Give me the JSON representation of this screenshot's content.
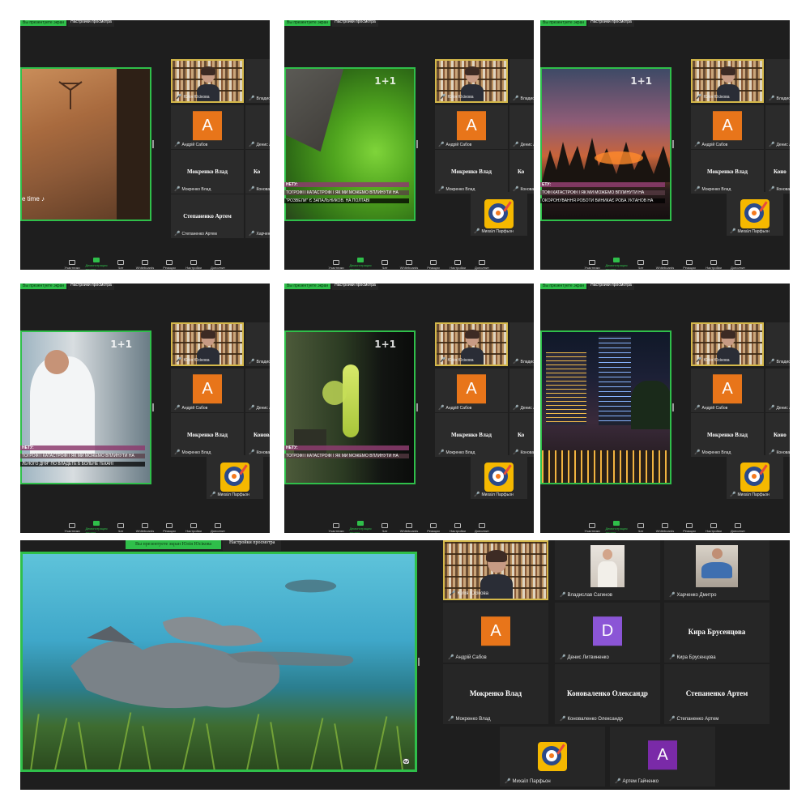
{
  "toolbar": [
    "Участники",
    "Демонстрация экрана",
    "Чат",
    "Whiteboards",
    "Реакции",
    "Настройки",
    "Дополнит"
  ],
  "share_bar": {
    "presenting": "Вы презентуете экран",
    "options": "Настройки просмотра"
  },
  "big_share_bar": {
    "presenting": "Вы презентуете экран Юлія Юсікова",
    "options": "Настройки просмотра"
  },
  "channel_logo": "1+1",
  "panel1_caption": "e time ♪",
  "panel2_tickers": [
    "НЕТУ:",
    "ТОГРОФІ Ї КАТАСТРОФІ І ЯК МИ МОЖЕМО ВПЛИНУТИ НА",
    "\"РОЗВЕЛИ\" Є ЗАПАЛЬНИКОВ. НА ПОЛТАВІ"
  ],
  "panel3_tickers": [
    "ЕТУ:",
    "ТОФІ КАТАСТРОФІ І ЯК МИ МОЖЕМО ВПЛИНУТИ НА",
    "ОКОРОНУВАННЯ РОБОТИ ВИНИКАЄ РОБА УКТАНОВ НА"
  ],
  "panel4_tickers": [
    "НЕТУ:",
    "ТОГРОФІ Ї КАТАСТРОФІ І ЯК МИ МОЖЕМО ВПЛИНУТИ НА",
    "ЛЬНОГО ДНЯ\" ПО ВЛАДЕТЕ Б БОЛЬНЕ   ГЕКАНІ"
  ],
  "panel5_tickers": [
    "НЕТУ:",
    "ТОГРОФІ Ї КАТАСТРОФІ І ЯК МИ МОЖЕМО ВПЛИНУТИ НА"
  ],
  "small_panels": [
    {
      "tiles": [
        {
          "type": "self",
          "label": "Юлія Юсікова"
        },
        {
          "type": "letter",
          "letter": "A",
          "color": "#e8751a",
          "label": "Андрій Сабов"
        },
        {
          "type": "name",
          "name": "Мокренко Влад",
          "label": "Мокренко Влад"
        },
        {
          "type": "name",
          "name": "Степаненко Артем",
          "label": "Степаненко Артем"
        },
        {
          "type": "cut",
          "label": "Владислав Сагинов"
        },
        {
          "type": "cut",
          "label": "Денис Литвиненко"
        },
        {
          "type": "cut",
          "name": "Ко",
          "label": "Коноваленко Олекс"
        },
        {
          "type": "cut",
          "label": "Харченко Дмитро"
        }
      ]
    },
    {
      "tiles": [
        {
          "type": "self",
          "label": "Юлія Юсікова"
        },
        {
          "type": "letter",
          "letter": "A",
          "color": "#e8751a",
          "label": "Андрій Сабов"
        },
        {
          "type": "name",
          "name": "Мокренко Влад",
          "label": "Мокренко Влад"
        },
        {
          "type": "egg",
          "label": "Михаїл Парфьон"
        },
        {
          "type": "cut",
          "label": "Владислав"
        },
        {
          "type": "cut",
          "label": "Денис Лит"
        },
        {
          "type": "cut",
          "name": "Ко",
          "label": "Коновал"
        }
      ]
    },
    {
      "tiles": [
        {
          "type": "self",
          "label": "Юлія Юсікова"
        },
        {
          "type": "letter",
          "letter": "A",
          "color": "#e8751a",
          "label": "Андрій Сабов"
        },
        {
          "type": "name",
          "name": "Мокренко Влад",
          "label": "Мокренко Влад"
        },
        {
          "type": "egg",
          "label": "Михаїл Парфьон"
        },
        {
          "type": "cut",
          "label": "Владислав Сагинов"
        },
        {
          "type": "cut",
          "label": "Денис Литвиненко"
        },
        {
          "type": "cut",
          "name": "Коно",
          "label": "Коноваленко Олекс"
        }
      ]
    },
    {
      "tiles": [
        {
          "type": "self",
          "label": "Юлія Юсікова"
        },
        {
          "type": "letter",
          "letter": "A",
          "color": "#e8751a",
          "label": "Андрій Сабов"
        },
        {
          "type": "name",
          "name": "Мокренко Влад",
          "label": "Мокренко Влад"
        },
        {
          "type": "egg",
          "label": "Михаїл Парфьон"
        },
        {
          "type": "cut",
          "label": "Владислав Сагин"
        },
        {
          "type": "cut",
          "label": "Денис Литвин"
        },
        {
          "type": "cut",
          "name": "Коновал",
          "label": "Коноваленко Олекс"
        }
      ]
    },
    {
      "tiles": [
        {
          "type": "self",
          "label": "Юлія Юсікова"
        },
        {
          "type": "letter",
          "letter": "A",
          "color": "#e8751a",
          "label": "Андрій Сабов"
        },
        {
          "type": "name",
          "name": "Мокренко Влад",
          "label": "Мокренко Влад"
        },
        {
          "type": "egg",
          "label": "Михаїл Парфьон"
        },
        {
          "type": "cut",
          "label": "Владислав"
        },
        {
          "type": "cut",
          "label": "Денис Лит"
        },
        {
          "type": "cut",
          "name": "Ко",
          "label": "Коновал"
        }
      ]
    },
    {
      "tiles": [
        {
          "type": "self",
          "label": "Юлія Юсікова"
        },
        {
          "type": "letter",
          "letter": "A",
          "color": "#e8751a",
          "label": "Андрій Сабов"
        },
        {
          "type": "name",
          "name": "Мокренко Влад",
          "label": "Мокренко Влад"
        },
        {
          "type": "egg",
          "label": "Михаїл Парфьон"
        },
        {
          "type": "cut",
          "label": "Владислав"
        },
        {
          "type": "cut",
          "label": "Денис Литв"
        },
        {
          "type": "cut",
          "name": "Коно",
          "label": "Коноваленко"
        }
      ]
    }
  ],
  "gallery": [
    {
      "type": "self",
      "label": "Юлія Юсікова"
    },
    {
      "type": "photo",
      "label": "Владислав Сагинов"
    },
    {
      "type": "photo2",
      "label": "Харченко Дмитро"
    },
    {
      "type": "letter",
      "letter": "A",
      "color": "#e8751a",
      "label": "Андрій Сабов"
    },
    {
      "type": "letter",
      "letter": "D",
      "color": "#8b55d6",
      "label": "Денис Литвиненко"
    },
    {
      "type": "name",
      "name": "Кира Брусенцова",
      "label": "Кира Брусенцова"
    },
    {
      "type": "name",
      "name": "Мокренко Влад",
      "label": "Мокренко Влад"
    },
    {
      "type": "name",
      "name": "Коноваленко Олександр",
      "label": "Коноваленко Олександр"
    },
    {
      "type": "name",
      "name": "Степаненко Артем",
      "label": "Степаненко Артем"
    },
    {
      "type": "egg",
      "label": "Михаїл Парфьон"
    },
    {
      "type": "letter",
      "letter": "A",
      "color": "#7a2aa8",
      "label": "Артем Гайченко"
    }
  ]
}
